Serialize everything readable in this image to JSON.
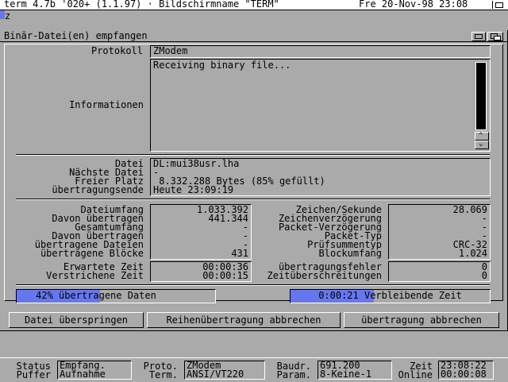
{
  "screen_bar": {
    "left": "term 4.7b '020+ (1.1.97) · Bildschirmname \"TERM\"",
    "right": "Fre 20-Nov-98  23:08"
  },
  "terminal_line": "z",
  "window": {
    "title": "Binär-Datei(en) empfangen"
  },
  "protocol": {
    "label": "Protokoll",
    "value": "ZModem"
  },
  "info": {
    "label": "Informationen",
    "text": "Receiving binary file..."
  },
  "file": {
    "labels": [
      "Datei",
      "Nächste Datei",
      "Freier Platz",
      "übertragungsende"
    ],
    "values": [
      "DL:mui38usr.lha",
      "-",
      " 8.332.288 Bytes (85% gefüllt)",
      "Heute 23:09:19"
    ]
  },
  "stats_left": {
    "labels": [
      "Dateiumfang",
      "Davon übertragen",
      "Gesamtumfang",
      "Davon übertragen",
      "übertragene Dateien",
      "übertragene Blöcke"
    ],
    "values": [
      "1.033.392",
      "441.344",
      "-",
      "-",
      "-",
      "431"
    ]
  },
  "stats_right": {
    "labels": [
      "Zeichen/Sekunde",
      "Zeichenverzögerung",
      "Packet-Verzögerung",
      "Packet-Typ",
      "Prüfsummentyp",
      "Blockumfang"
    ],
    "values": [
      "28.069",
      "-",
      "-",
      "-",
      "CRC-32",
      "1.024"
    ]
  },
  "time_left": {
    "labels": [
      "Erwartete Zeit",
      "Verstrichene Zeit"
    ],
    "values": [
      "00:00:36",
      "00:00:15"
    ]
  },
  "time_right": {
    "labels": [
      "übertragungsfehler",
      "Zeitüberschreitungen"
    ],
    "values": [
      "0",
      "0"
    ]
  },
  "progress_data": {
    "text": "42% übertragene Daten",
    "fraction": 0.42
  },
  "progress_time": {
    "text": "0:00:21 Verbleibende Zeit",
    "fraction": 0.42
  },
  "buttons": {
    "skip": "Datei überspringen",
    "abort_batch": "Reihenübertragung abbrechen",
    "abort": "übertragung abbrechen"
  },
  "statusbar": {
    "status_label": "Status",
    "buffer_label": "Puffer",
    "status_value": "Empfang.",
    "buffer_value": "Aufnahme",
    "proto_label": "Proto.",
    "term_label": "Term.",
    "proto_value": "ZModem",
    "term_value": "ANSI/VT220",
    "baud_label": "Baudr.",
    "param_label": "Param.",
    "baud_value": "691.200",
    "param_value": "8-Keine-1",
    "time_label": "Zeit",
    "online_label": "Online",
    "time_value": "23:08:22",
    "online_value": "00:00:08"
  },
  "colors": {
    "background": "#aaaaaa",
    "accent": "#6677ee",
    "window_bg": "#aaaaaa",
    "bar": "#ffffff"
  }
}
